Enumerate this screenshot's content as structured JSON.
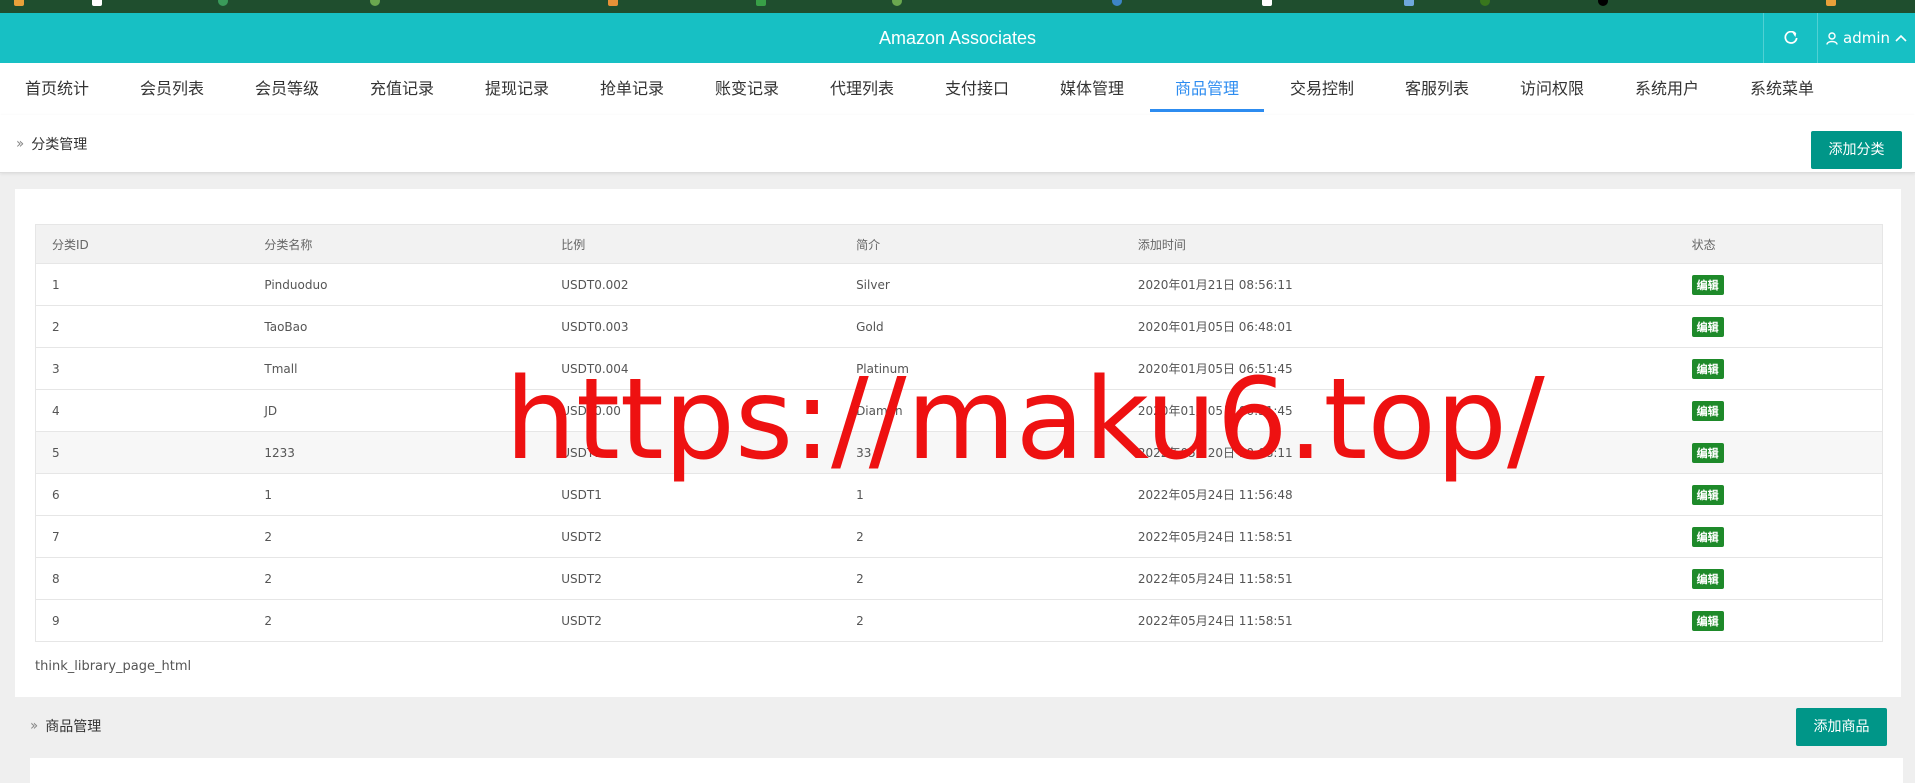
{
  "app": {
    "title": "Amazon Associates",
    "user_label": "admin",
    "accent_color": "#17c0c4"
  },
  "nav": {
    "items": [
      {
        "label": "首页统计"
      },
      {
        "label": "会员列表"
      },
      {
        "label": "会员等级"
      },
      {
        "label": "充值记录"
      },
      {
        "label": "提现记录"
      },
      {
        "label": "抢单记录"
      },
      {
        "label": "账变记录"
      },
      {
        "label": "代理列表"
      },
      {
        "label": "支付接口"
      },
      {
        "label": "媒体管理"
      },
      {
        "label": "商品管理"
      },
      {
        "label": "交易控制"
      },
      {
        "label": "客服列表"
      },
      {
        "label": "访问权限"
      },
      {
        "label": "系统用户"
      },
      {
        "label": "系统菜单"
      }
    ],
    "active": "商品管理"
  },
  "category_section": {
    "breadcrumb": "分类管理",
    "add_button": "添加分类",
    "columns": [
      "分类ID",
      "分类名称",
      "比例",
      "简介",
      "添加时间",
      "状态"
    ],
    "rows": [
      {
        "id": "1",
        "name": "Pinduoduo",
        "ratio": "USDT0.002",
        "intro": "Silver",
        "time": "2020年01月21日 08:56:11",
        "action": "编辑"
      },
      {
        "id": "2",
        "name": "TaoBao",
        "ratio": "USDT0.003",
        "intro": "Gold",
        "time": "2020年01月05日 06:48:01",
        "action": "编辑"
      },
      {
        "id": "3",
        "name": "Tmall",
        "ratio": "USDT0.004",
        "intro": "Platinum",
        "time": "2020年01月05日 06:51:45",
        "action": "编辑"
      },
      {
        "id": "4",
        "name": "JD",
        "ratio": "USDT0.00",
        "intro": "Diamon",
        "time": "2020年01月05日 06:51:45",
        "action": "编辑"
      },
      {
        "id": "5",
        "name": "1233",
        "ratio": "USDT1",
        "intro": "33",
        "time": "2022年05月20日 10:08:11",
        "action": "编辑"
      },
      {
        "id": "6",
        "name": "1",
        "ratio": "USDT1",
        "intro": "1",
        "time": "2022年05月24日 11:56:48",
        "action": "编辑"
      },
      {
        "id": "7",
        "name": "2",
        "ratio": "USDT2",
        "intro": "2",
        "time": "2022年05月24日 11:58:51",
        "action": "编辑"
      },
      {
        "id": "8",
        "name": "2",
        "ratio": "USDT2",
        "intro": "2",
        "time": "2022年05月24日 11:58:51",
        "action": "编辑"
      },
      {
        "id": "9",
        "name": "2",
        "ratio": "USDT2",
        "intro": "2",
        "time": "2022年05月24日 11:58:51",
        "action": "编辑"
      }
    ],
    "pager_text": "think_library_page_html"
  },
  "goods_section": {
    "breadcrumb": "商品管理",
    "add_button": "添加商品"
  },
  "watermark": {
    "text": "https://maku6.top/",
    "color": "#ee1111"
  },
  "edit_button_color": "#1e8a2a"
}
